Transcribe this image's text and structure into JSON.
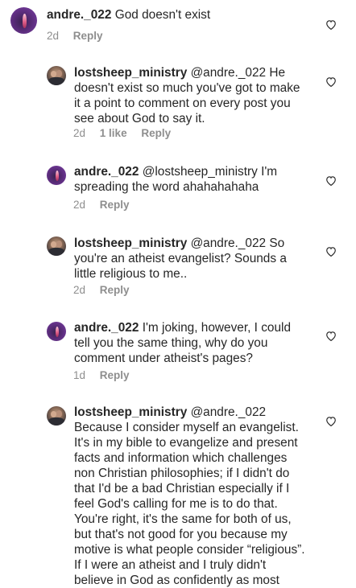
{
  "comments": [
    {
      "username": "andre._022",
      "lines": [
        "God doesn't exist"
      ],
      "time": "2d",
      "likes": "",
      "reply": "Reply"
    },
    {
      "username": "lostsheep_ministry",
      "lines": [
        "@andre._022 He",
        "doesn't exist so much you've got to make",
        "it a point to comment on every post you",
        "see about God to say it."
      ],
      "time": "2d",
      "likes": "1 like",
      "reply": "Reply"
    },
    {
      "username": "andre._022",
      "lines": [
        "@lostsheep_ministry I'm",
        "spreading the word ahahahahaha"
      ],
      "time": "2d",
      "likes": "",
      "reply": "Reply"
    },
    {
      "username": "lostsheep_ministry",
      "lines": [
        "@andre._022 So",
        "you're an atheist evangelist? Sounds a",
        "little religious to me.."
      ],
      "time": "2d",
      "likes": "",
      "reply": "Reply"
    },
    {
      "username": "andre._022",
      "lines": [
        "I'm joking, however, I could",
        "tell you the same thing, why do you",
        "comment under atheist's pages?"
      ],
      "time": "1d",
      "likes": "",
      "reply": "Reply"
    },
    {
      "username": "lostsheep_ministry",
      "lines": [
        "@andre._022",
        "Because I consider myself an evangelist.",
        "It's in my bible to evangelize and present",
        "facts and information which challenges",
        "non Christian philosophies; if I didn't do",
        "that I'd be a bad Christian especially if I",
        "feel God's calling for me is to do that.",
        "You're right, it's the same for both of us,",
        "but that's not good for you because my",
        "motive is what people consider “religious”.",
        "If I were an atheist and I truly didn't",
        "believe in God as confidently as most"
      ],
      "time": "",
      "likes": "",
      "reply": ""
    }
  ]
}
